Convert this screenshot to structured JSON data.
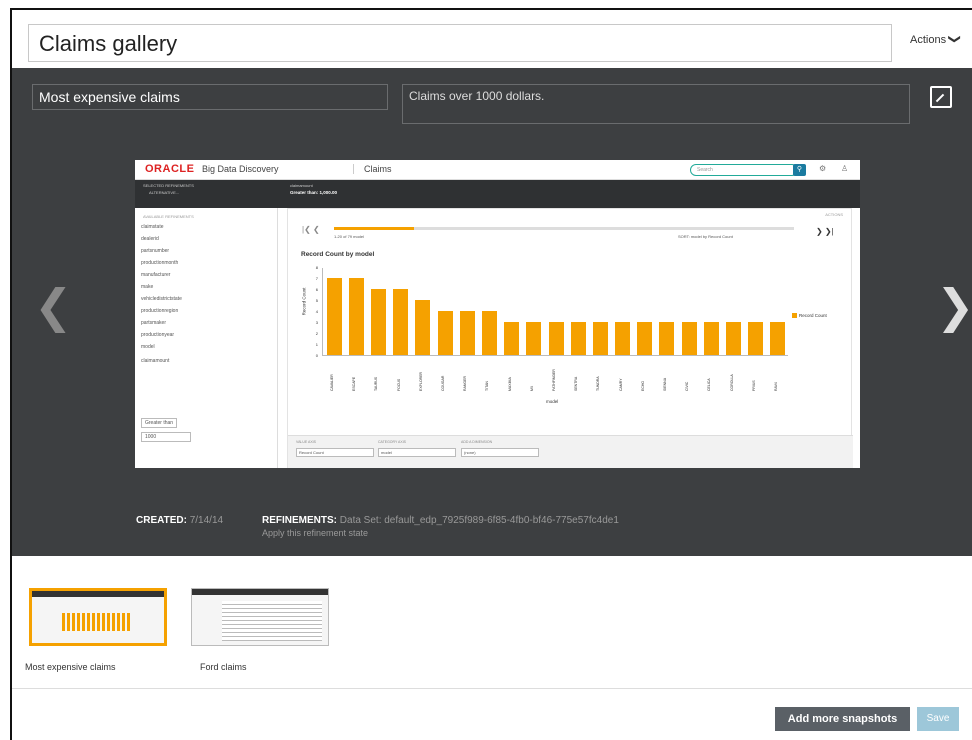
{
  "header": {
    "title": "Claims gallery",
    "actions_label": "Actions",
    "actions_chevron": "❯"
  },
  "snapshot": {
    "title": "Most expensive claims",
    "description": "Claims over 1000 dollars.",
    "prev_arrow": "❮",
    "next_arrow": "❯",
    "created_label": "CREATED:",
    "created_value": "7/14/14",
    "refinements_label": "REFINEMENTS:",
    "refinements_value": "Data Set: default_edp_7925f989-6f85-4fb0-bf46-775e57fc4de1",
    "apply_link": "Apply this refinement state"
  },
  "embedded": {
    "brand": "ORACLE",
    "product": "Big Data Discovery",
    "tab": "Claims",
    "search_placeholder": "Search",
    "selected_refinements_label": "SELECTED REFINEMENTS",
    "selected_refinement_value": "ALTERNATIVE...",
    "claim_amount_label": "claimamount",
    "claim_amount_value": "Greater than: 1,000.00",
    "available_refinements_label": "AVAILABLE REFINEMENTS",
    "refinements": [
      "claimstate",
      "dealerid",
      "partsnumber",
      "productionmonth",
      "manufacturer",
      "make",
      "vehicledistrictstate",
      "productionregion",
      "partsmaker",
      "productionyear",
      "model",
      "claimamount"
    ],
    "filter_value": "Greater than",
    "filter_input": "1000",
    "actions_label": "ACTIONS",
    "pager_label": "1-20 of 79 model",
    "sort_label": "SORT: model by Record Count",
    "footer": {
      "value_axis_label": "VALUE AXIS",
      "value_axis": "Record Count",
      "category_axis_label": "CATEGORY AXIS",
      "category_axis": "model",
      "dimension_label": "ADD A DIMENSION",
      "dimension": "(none)"
    }
  },
  "chart_data": {
    "type": "bar",
    "title": "Record Count by model",
    "xlabel": "model",
    "ylabel": "Record Count",
    "ylim": [
      0,
      8
    ],
    "yticks": [
      0,
      1,
      2,
      3,
      4,
      5,
      6,
      7,
      8
    ],
    "categories": [
      "CAVALIER",
      "ESCAPE",
      "TAURUS",
      "FOCUS",
      "EXPLORER",
      "COUGAR",
      "RANGER",
      "TITAN",
      "MAXIMA",
      "MX",
      "PATHFINDER",
      "SENTRA",
      "TUNDRA",
      "CAMRY",
      "ECHO",
      "SIENNA",
      "CIVIC",
      "CELICA",
      "COROLLA",
      "PRIUS",
      "RAV4"
    ],
    "series": [
      {
        "name": "Record Count",
        "values": [
          7,
          7,
          6,
          6,
          5,
          4,
          4,
          4,
          3,
          3,
          3,
          3,
          3,
          3,
          3,
          3,
          3,
          3,
          3,
          3,
          3
        ]
      }
    ],
    "color": "#f5a100",
    "legend": "right"
  },
  "gallery": {
    "items": [
      {
        "label": "Most expensive claims",
        "selected": true
      },
      {
        "label": "Ford claims",
        "selected": false
      }
    ]
  },
  "buttons": {
    "add_snapshots": "Add more snapshots",
    "save": "Save"
  }
}
